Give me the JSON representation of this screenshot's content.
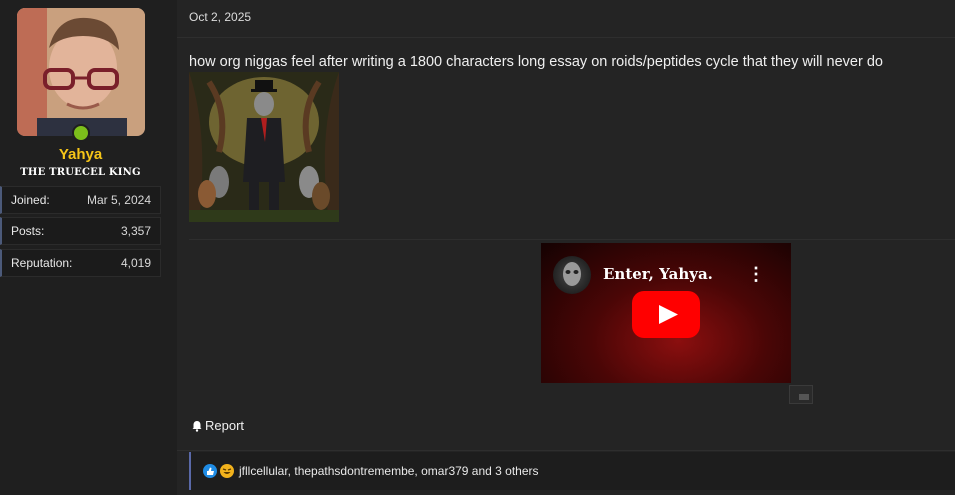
{
  "user": {
    "name": "Yahya",
    "title": "THE TRUECEL KING",
    "stats": [
      {
        "label": "Joined:",
        "value": "Mar 5, 2024"
      },
      {
        "label": "Posts:",
        "value": "3,357"
      },
      {
        "label": "Reputation:",
        "value": "4,019"
      }
    ],
    "online": true
  },
  "post": {
    "date": "Oct 2, 2025",
    "message": "how org niggas feel after writing a 1800 characters long essay on roids/peptides cycle that they will never do",
    "video": {
      "title": "Enter, Yahya."
    }
  },
  "actions": {
    "report_label": "Report"
  },
  "reactions": {
    "icons": [
      "like-icon",
      "laugh-icon"
    ],
    "text": "jfllcellular, thepathsdontremembe, omar379 and 3 others"
  },
  "colors": {
    "background": "#242424",
    "sidebar": "#1f1f1f",
    "username": "#f5c518",
    "online": "#7cbf1b",
    "youtube_red": "#ff0000",
    "accent_border": "#5a69a8"
  }
}
